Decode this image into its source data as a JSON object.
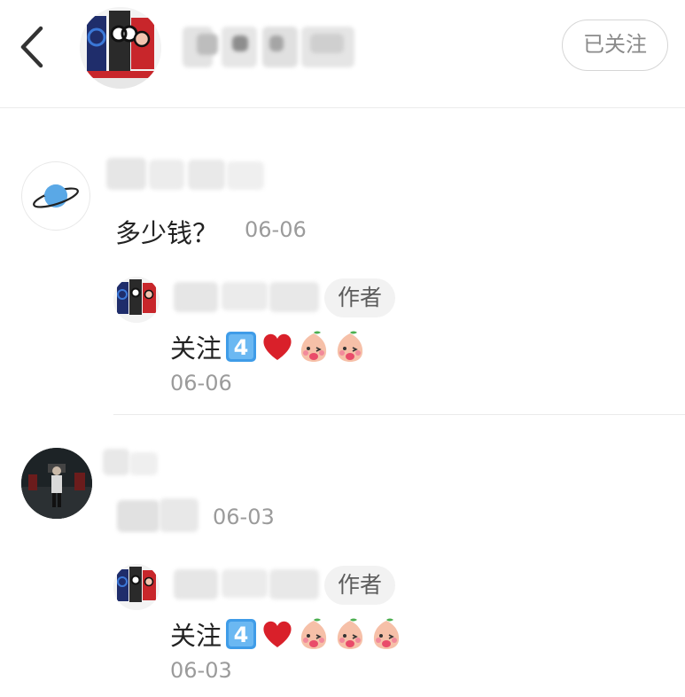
{
  "header": {
    "follow_label": "已关注",
    "icons": [
      "back-icon",
      "user-avatar"
    ]
  },
  "comments": [
    {
      "text": "多少钱？",
      "date": "06-06",
      "reply": {
        "tag": "作者",
        "text": "关注",
        "emojis": [
          "keycap-4-emoji",
          "red-heart-emoji",
          "peach-baby-emoji",
          "peach-baby-emoji"
        ],
        "date": "06-06"
      }
    },
    {
      "text": "",
      "date": "06-03",
      "reply": {
        "tag": "作者",
        "text": "关注",
        "emojis": [
          "keycap-4-emoji",
          "red-heart-emoji",
          "peach-baby-emoji",
          "peach-baby-emoji",
          "peach-baby-emoji"
        ],
        "date": "06-03"
      }
    }
  ],
  "colors": {
    "text": "#222222",
    "muted": "#9b9b9b",
    "tag_bg": "#f2f2f2",
    "heart": "#d9202a",
    "keycap": "#3f9ce8"
  }
}
